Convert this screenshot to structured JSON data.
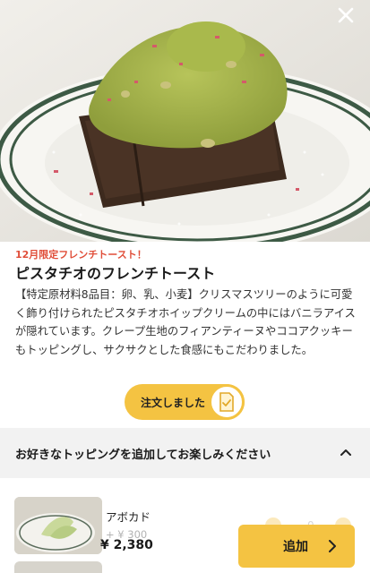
{
  "hero": {
    "image_alt": "pistachio-french-toast-photo"
  },
  "product": {
    "badge": "12月限定フレンチトースト！",
    "title": "ピスタチオのフレンチトースト",
    "description": "【特定原材料8品目：卵、乳、小麦】クリスマスツリーのように可愛く飾り付けられたピスタチオホイップクリームの中にはバニラアイスが隠れています。クレープ生地のフィアンティーヌやココアクッキーもトッピングし、サクサクとした食感にもこだわりました。"
  },
  "order_status": {
    "label": "注文しました",
    "icon": "order-check-icon"
  },
  "toppings": {
    "header": "お好きなトッピングを追加してお楽しみください",
    "items": [
      {
        "name": "アボカド",
        "price": "+ ¥ 300"
      }
    ]
  },
  "footer": {
    "total": "¥ 2,380",
    "add_label": "追加"
  },
  "colors": {
    "accent": "#f4c342",
    "badge_red": "#e04e39",
    "header_bg": "#f2f2f2"
  }
}
